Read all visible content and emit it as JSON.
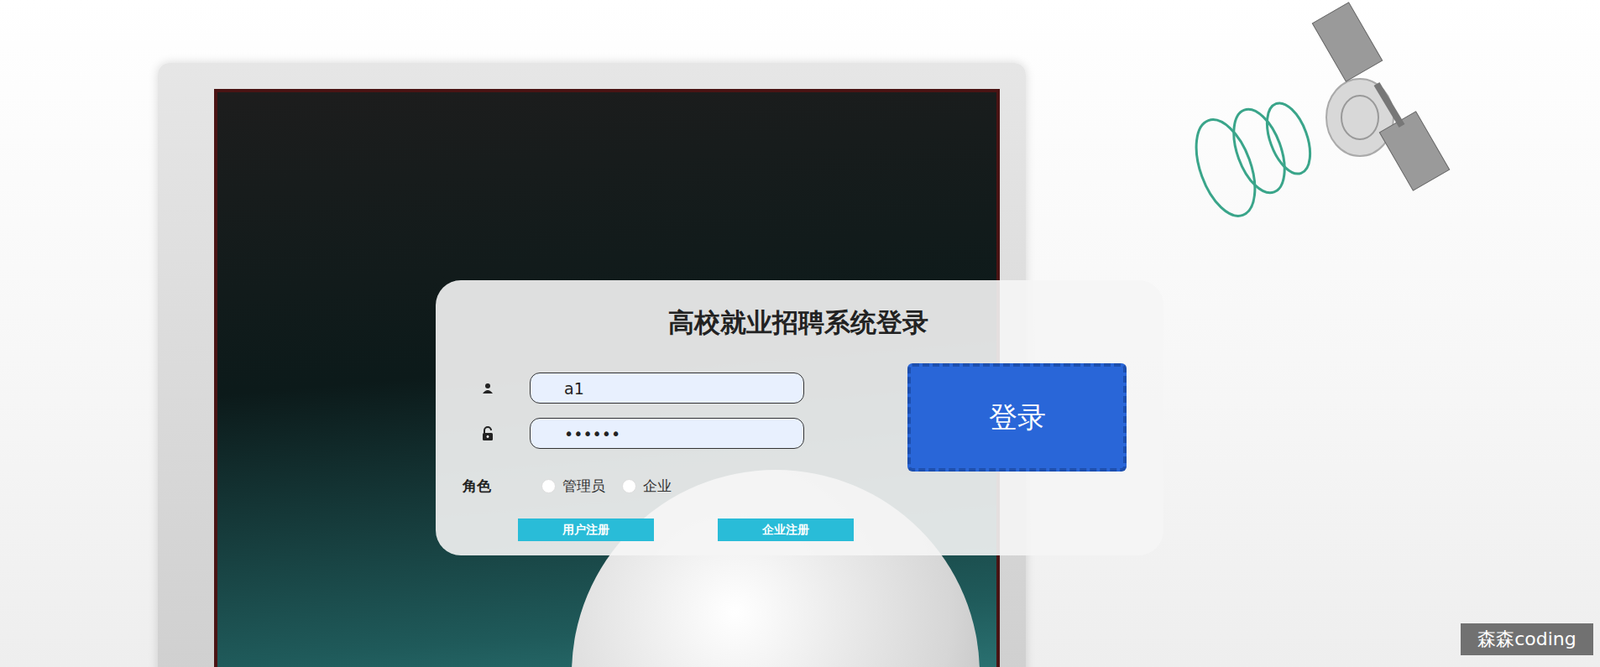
{
  "title": "高校就业招聘系统登录",
  "fields": [
    {
      "kind": "text",
      "value": "a1"
    },
    {
      "kind": "password",
      "value": "••••••"
    }
  ],
  "role": {
    "label": "角色",
    "options": [
      {
        "label": "管理员",
        "selected": false
      },
      {
        "label": "企业",
        "selected": false
      }
    ]
  },
  "register_buttons": [
    "用户注册",
    "企业注册"
  ],
  "login_button": "登录",
  "watermark": "森森coding"
}
